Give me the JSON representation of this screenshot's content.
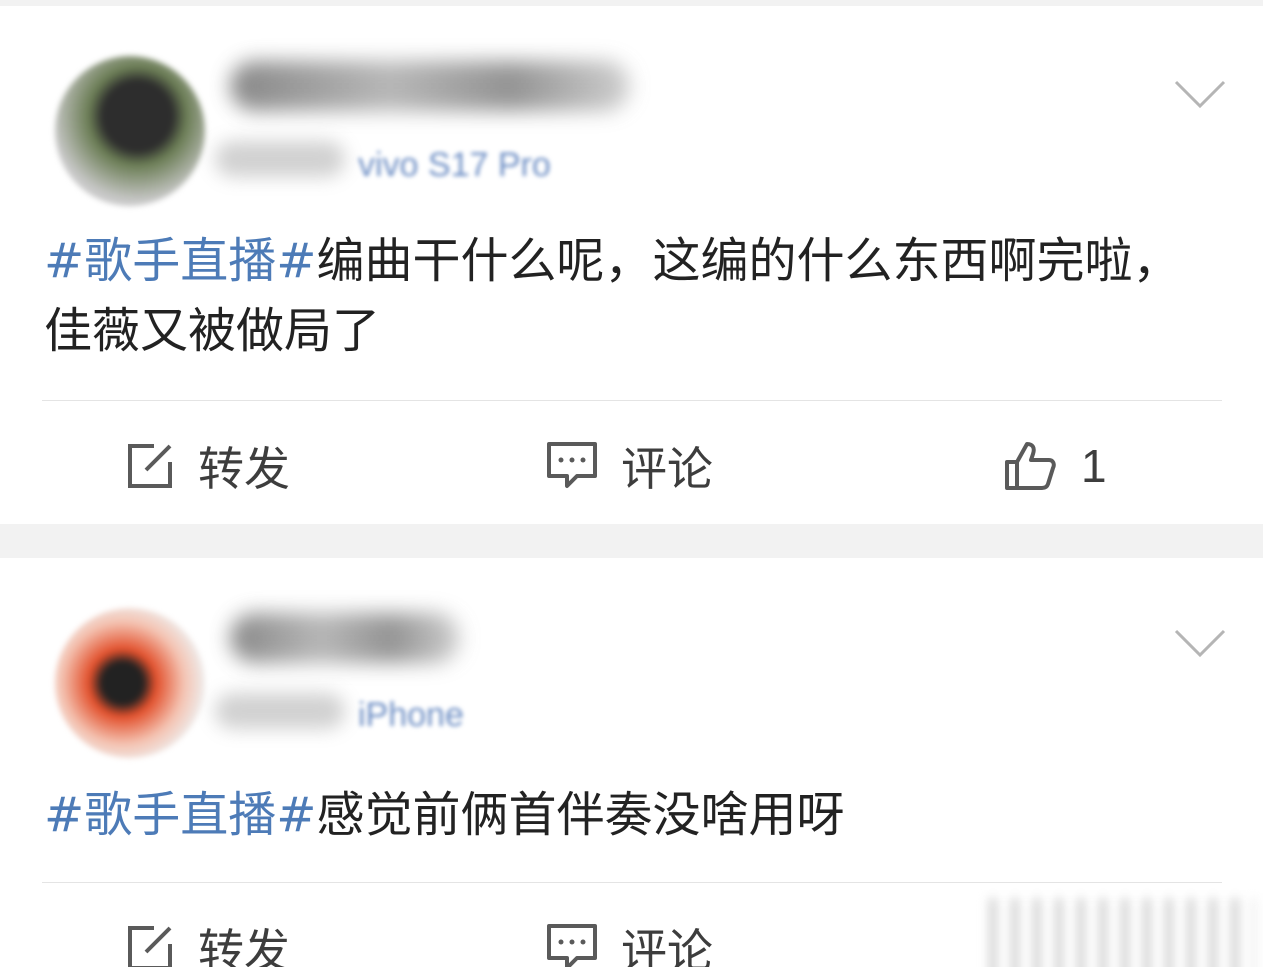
{
  "posts": [
    {
      "meta_device": "vivo S17 Pro",
      "content_hashtag": "#歌手直播#",
      "content_text": "编曲干什么呢，这编的什么东西啊完啦，佳薇又被做局了",
      "actions": {
        "repost_label": "转发",
        "comment_label": "评论",
        "like_count": "1"
      }
    },
    {
      "meta_device": "iPhone",
      "content_hashtag": "#歌手直播#",
      "content_text": "感觉前俩首伴奏没啥用呀",
      "actions": {
        "repost_label": "转发",
        "comment_label": "评论"
      }
    }
  ],
  "colors": {
    "hashtag": "#4d7bb7",
    "text": "#222222",
    "icon": "#5a5a5a",
    "background": "#f2f2f2"
  },
  "icons": [
    "edit-square-icon",
    "comment-bubble-icon",
    "thumbs-up-icon",
    "chevron-down-icon"
  ]
}
